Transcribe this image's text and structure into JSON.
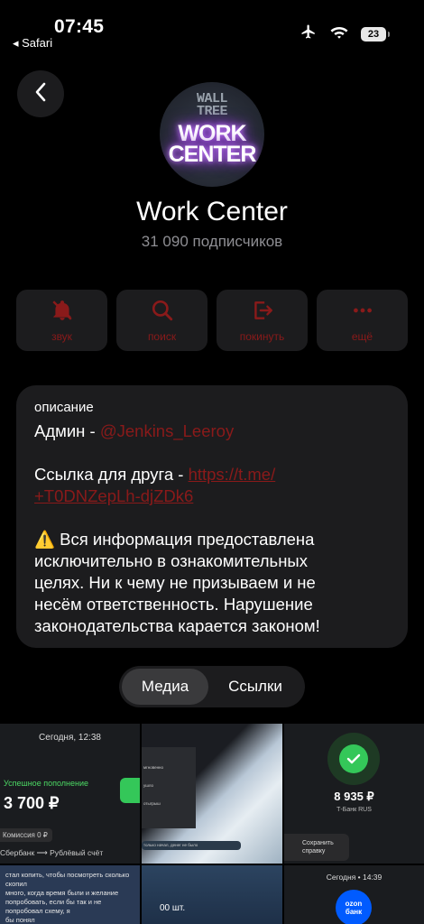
{
  "status_bar": {
    "time": "07:45",
    "back_app": "◂ Safari",
    "battery": "23"
  },
  "channel": {
    "avatar_top_text": "WALL\nTREE",
    "avatar_main_text": "WORK\nCENTER",
    "title": "Work Center",
    "subscribers": "31 090 подписчиков"
  },
  "actions": [
    {
      "label": "звук",
      "icon": "bell-slash-icon"
    },
    {
      "label": "поиск",
      "icon": "search-icon"
    },
    {
      "label": "покинуть",
      "icon": "leave-icon"
    },
    {
      "label": "ещё",
      "icon": "more-icon"
    }
  ],
  "description": {
    "label": "описание",
    "admin_prefix": "Админ - ",
    "admin_link": "@Jenkins_Leeroy",
    "friend_prefix": "Ссылка для друга - ",
    "friend_link_1": "https://t.me/",
    "friend_link_2": "+T0DNZepLh-djZDk6",
    "warning_lines": [
      "⚠️ Вся информация предоставлена",
      "исключительно в ознакомительных",
      "целях. Ни к чему не призываем и не",
      "несём ответственность. Нарушение",
      "законодательства карается законом!"
    ]
  },
  "tabs": {
    "media": "Медиа",
    "links": "Ссылки"
  },
  "media": {
    "c1": {
      "date": "Сегодня, 12:38",
      "status": "Успешное пополнение",
      "amount": "3 700 ₽",
      "fee": "Комиссия 0 ₽",
      "route": "Сбербанк ⟶ Рублёвый счёт"
    },
    "c2": {
      "mini1": "мгновенно",
      "mini2": "ушло",
      "mini3": "отыгрыш",
      "bubble": "только начал, денег не было"
    },
    "c3": {
      "sum": "8 935 ₽",
      "bank": "Т-Банк RUS",
      "save": "Сохранить справку"
    },
    "c4": {
      "msg": "стал копить, чтобы посмотреть сколько\nскопил\nмного, когда время были и желание\nпопробовать, если бы так и не попробовал схему, я\nбы понял"
    },
    "c5": {
      "ticker": "00 шт."
    },
    "c6": {
      "date": "Сегодня • 14:39",
      "ozon": "ozon\nбанк"
    }
  }
}
